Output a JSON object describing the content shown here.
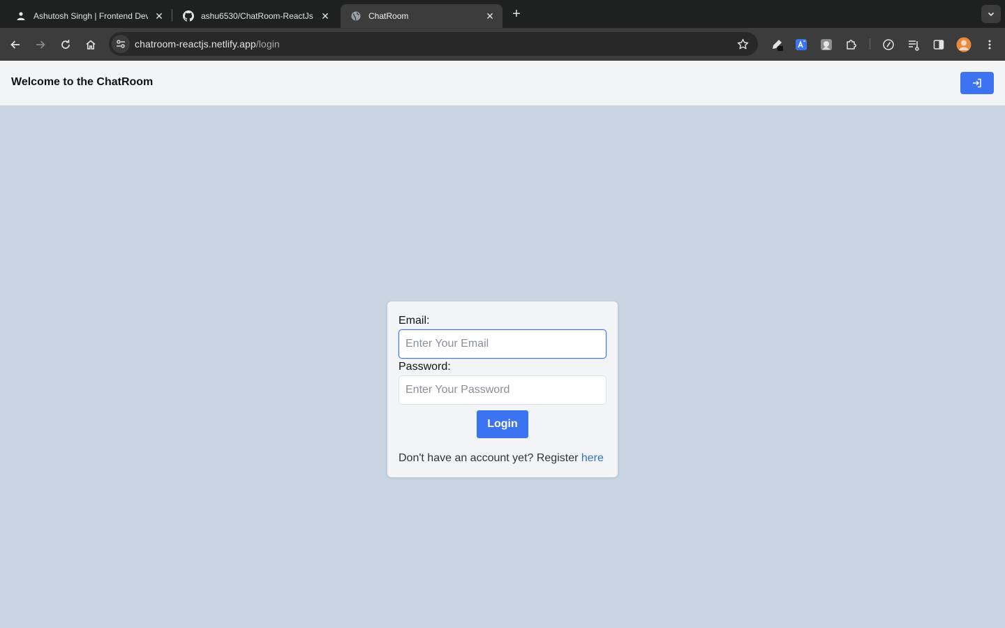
{
  "browser": {
    "tabs": [
      {
        "title": "Ashutosh Singh | Frontend Developer",
        "icon": "person-favicon-icon",
        "active": false
      },
      {
        "title": "ashu6530/ChatRoom-ReactJs",
        "icon": "github-icon",
        "active": false
      },
      {
        "title": "ChatRoom",
        "icon": "globe-icon",
        "active": true
      }
    ],
    "close_glyph": "✕",
    "newtab_glyph": "+",
    "url_host": "chatroom-reactjs.netlify.app",
    "url_path": "/login"
  },
  "header": {
    "title": "Welcome to the ChatRoom",
    "login_icon": "sign-in-icon"
  },
  "login_form": {
    "email_label": "Email:",
    "email_placeholder": "Enter Your Email",
    "email_value": "",
    "password_label": "Password:",
    "password_placeholder": "Enter Your Password",
    "password_value": "",
    "submit_label": "Login",
    "register_text": "Don't have an account yet? Register ",
    "register_link": "here"
  },
  "colors": {
    "accent": "#3b73f0",
    "page_background": "#c9d5e3",
    "header_background": "#f3f4f6",
    "link": "#2f6fe0"
  }
}
